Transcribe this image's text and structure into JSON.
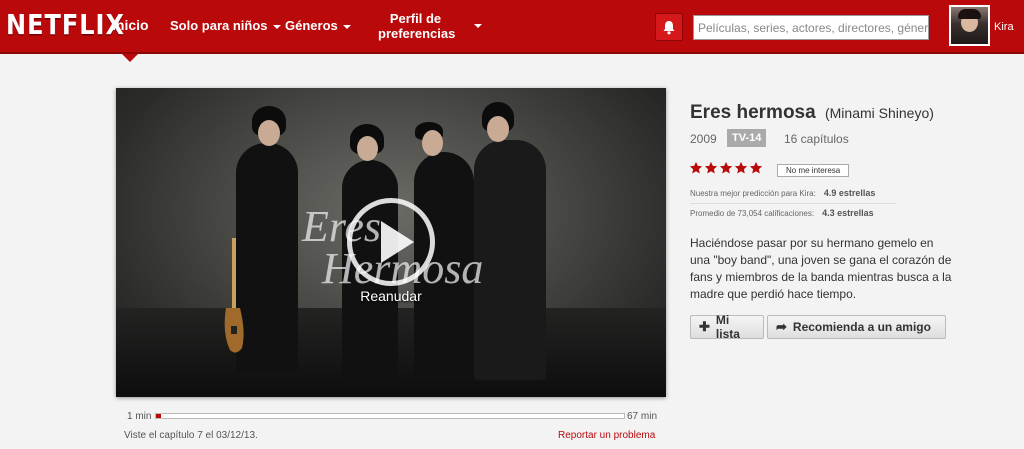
{
  "header": {
    "logo": "NETFLIX",
    "nav": {
      "home": "Inicio",
      "kids": "Solo para niños",
      "genres": "Géneros",
      "profile_line1": "Perfil de",
      "profile_line2": "preferencias"
    },
    "search_placeholder": "Películas, series, actores, directores, géneros",
    "user_name": "Kira",
    "icons": {
      "notifications": "bell-icon"
    }
  },
  "player": {
    "title_art_line1": "Eres",
    "title_art_line2": "Hermosa",
    "resume_label": "Reanudar"
  },
  "progress": {
    "start_label": "1 min",
    "end_label": "67 min",
    "fraction": 0.01,
    "watched_text": "Viste el capítulo 7 el 03/12/13.",
    "report_link": "Reportar un problema"
  },
  "details": {
    "title": "Eres hermosa",
    "alt_title": "(Minami Shineyo)",
    "year": "2009",
    "maturity": "TV-14",
    "episodes": "16 capítulos",
    "stars": 5,
    "star_color": "#b9090b",
    "not_interested": "No me interesa",
    "prediction_label": "Nuestra mejor predicción para Kira:",
    "prediction_value": "4.9 estrellas",
    "average_label": "Promedio de 73,054 calificaciones:",
    "average_value": "4.3 estrellas",
    "synopsis": "Haciéndose pasar por su hermano gemelo en una \"boy band\", una joven se gana el corazón de fans y miembros de la banda mientras busca a la madre que perdió hace tiempo.",
    "my_list_label": "Mi lista",
    "recommend_label": "Recomienda a un amigo"
  },
  "colors": {
    "brand": "#b9090b",
    "background": "#f3f3f3"
  }
}
